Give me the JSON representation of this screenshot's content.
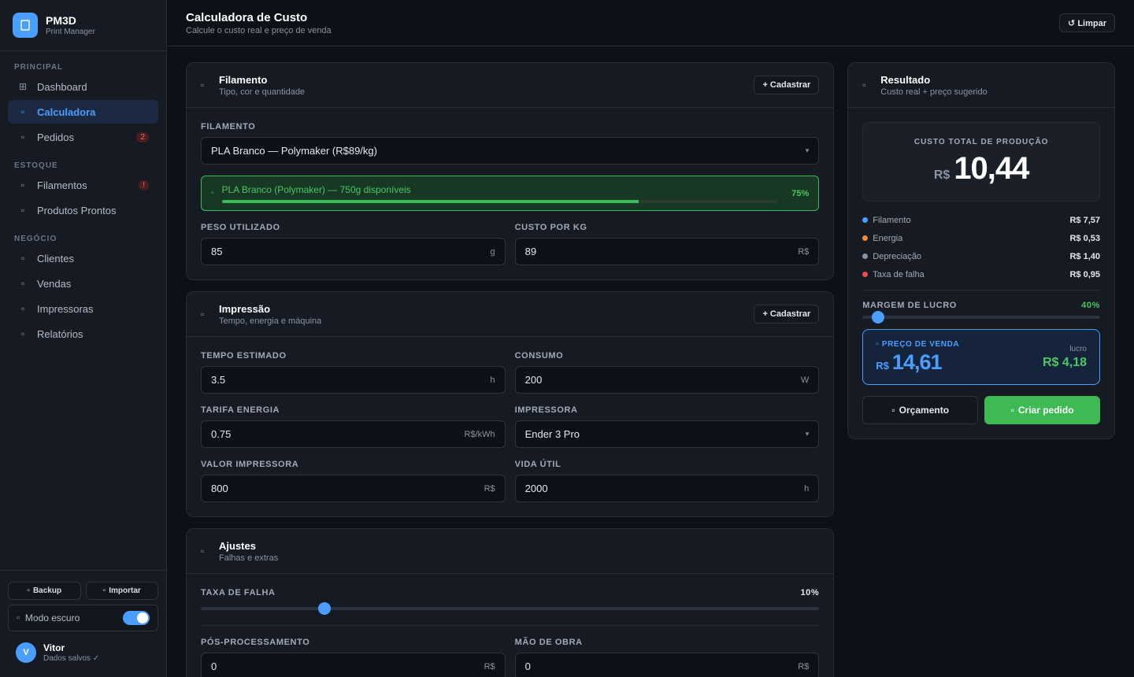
{
  "brand": {
    "name": "PM3D",
    "subtitle": "Print Manager"
  },
  "sidebar": {
    "sections": [
      {
        "title": "PRINCIPAL",
        "items": [
          {
            "label": "Dashboard",
            "icon": "grid-icon"
          },
          {
            "label": "Calculadora",
            "icon": "calculator-icon",
            "active": true
          },
          {
            "label": "Pedidos",
            "icon": "package-icon",
            "badge": "2"
          }
        ]
      },
      {
        "title": "ESTOQUE",
        "items": [
          {
            "label": "Filamentos",
            "icon": "spool-icon",
            "badge": "!"
          },
          {
            "label": "Produtos Prontos",
            "icon": "box-icon"
          }
        ]
      },
      {
        "title": "NEGÓCIO",
        "items": [
          {
            "label": "Clientes",
            "icon": "users-icon"
          },
          {
            "label": "Vendas",
            "icon": "cart-icon"
          },
          {
            "label": "Impressoras",
            "icon": "printer-icon"
          },
          {
            "label": "Relatórios",
            "icon": "report-icon"
          }
        ]
      }
    ],
    "backup_label": "Backup",
    "import_label": "Importar",
    "dark_mode_label": "Modo escuro",
    "dark_mode_on": true,
    "user": {
      "initial": "V",
      "name": "Vitor",
      "status": "Dados salvos ✓"
    }
  },
  "header": {
    "title": "Calculadora de Custo",
    "subtitle": "Calcule o custo real e preço de venda",
    "clear_label": "↺ Limpar"
  },
  "filament_card": {
    "title": "Filamento",
    "subtitle": "Tipo, cor e quantidade",
    "add_label": "+ Cadastrar",
    "filament_label": "FILAMENTO",
    "filament_value": "PLA Branco — Polymaker (R$89/kg)",
    "stock_text": "PLA Branco (Polymaker) — 750g disponíveis",
    "stock_percent": 75,
    "stock_percent_label": "75%",
    "weight_label": "PESO UTILIZADO",
    "weight_value": "85",
    "weight_unit": "g",
    "cost_label": "CUSTO POR KG",
    "cost_value": "89",
    "cost_unit": "R$"
  },
  "print_card": {
    "title": "Impressão",
    "subtitle": "Tempo, energia e máquina",
    "add_label": "+ Cadastrar",
    "time_label": "TEMPO ESTIMADO",
    "time_value": "3.5",
    "time_unit": "h",
    "power_label": "CONSUMO",
    "power_value": "200",
    "power_unit": "W",
    "tariff_label": "TARIFA ENERGIA",
    "tariff_value": "0.75",
    "tariff_unit": "R$/kWh",
    "printer_label": "IMPRESSORA",
    "printer_value": "Ender 3 Pro",
    "printer_price_label": "VALOR IMPRESSORA",
    "printer_price_value": "800",
    "printer_price_unit": "R$",
    "lifetime_label": "VIDA ÚTIL",
    "lifetime_value": "2000",
    "lifetime_unit": "h"
  },
  "adjust_card": {
    "title": "Ajustes",
    "subtitle": "Falhas e extras",
    "failure_label": "TAXA DE FALHA",
    "failure_value_label": "10%",
    "failure_fraction": 0.2,
    "post_label": "PÓS-PROCESSAMENTO",
    "post_value": "0",
    "post_unit": "R$",
    "labor_label": "MÃO DE OBRA",
    "labor_value": "0",
    "labor_unit": "R$"
  },
  "result_card": {
    "title": "Resultado",
    "subtitle": "Custo real + preço sugerido",
    "total_label": "CUSTO TOTAL DE PRODUÇÃO",
    "total_currency": "R$",
    "total_value": "10,44",
    "breakdown": [
      {
        "label": "Filamento",
        "amount": "R$ 7,57",
        "color": "#4a9eff"
      },
      {
        "label": "Energia",
        "amount": "R$ 0,53",
        "color": "#f5893d"
      },
      {
        "label": "Depreciação",
        "amount": "R$ 1,40",
        "color": "#8a93a3"
      },
      {
        "label": "Taxa de falha",
        "amount": "R$ 0,95",
        "color": "#ef4b4b"
      }
    ],
    "margin_label": "MARGEM DE LUCRO",
    "margin_value_label": "40%",
    "margin_fraction": 0.04,
    "price_label": "PREÇO DE VENDA",
    "price_currency": "R$",
    "price_value": "14,61",
    "profit_label": "lucro",
    "profit_value": "R$ 4,18",
    "quote_label": "Orçamento",
    "order_label": "Criar pedido"
  },
  "colors": {
    "accent": "#4a9eff",
    "success": "#3dba54",
    "danger": "#ef4b4b",
    "background": "#0d1016",
    "panel": "#161a22"
  }
}
